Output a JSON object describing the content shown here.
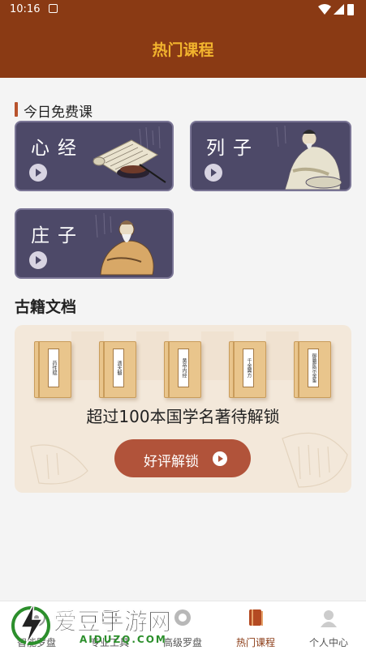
{
  "status_bar": {
    "time": "10:16"
  },
  "header": {
    "title": "热门课程"
  },
  "free_section": {
    "title": "今日免费课"
  },
  "courses": [
    {
      "title": "心经"
    },
    {
      "title": "列子"
    },
    {
      "title": "庄子"
    }
  ],
  "docs_section": {
    "title": "古籍文档"
  },
  "books": [
    "药性赋",
    "滴天髓",
    "黄帝内经",
    "千金翼方",
    "御纂医宗金鉴"
  ],
  "promo": {
    "text": "超过100本国学名著待解锁",
    "button_label": "好评解锁"
  },
  "tabs": [
    {
      "label": "智能罗盘"
    },
    {
      "label": "专业工具"
    },
    {
      "label": "高级罗盘"
    },
    {
      "label": "热门课程",
      "active": true
    },
    {
      "label": "个人中心"
    }
  ],
  "watermark": {
    "title": "爱豆手游网",
    "url": "AIDUZQ.COM"
  },
  "colors": {
    "header_bg": "#8a3a14",
    "header_title": "#f2b42e",
    "card_bg": "#4d4968",
    "accent": "#b1533a"
  }
}
